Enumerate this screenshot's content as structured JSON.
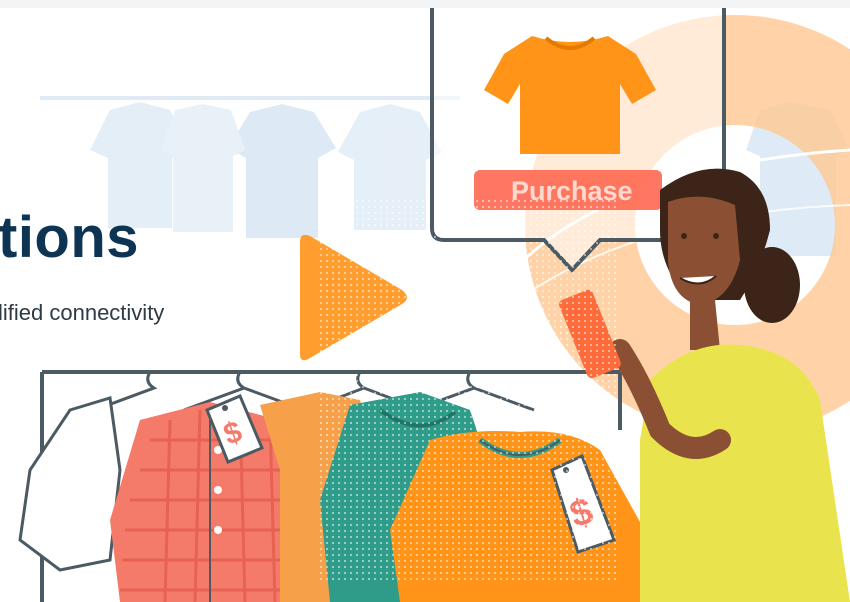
{
  "hero": {
    "headline": "tions",
    "subheadline": "lified connectivity"
  },
  "product_card": {
    "button_label": "Purchase",
    "item_icon": "tshirt-icon"
  },
  "video": {
    "control_icon": "play-icon"
  },
  "price_tags": {
    "symbol": "$"
  },
  "colors": {
    "headline": "#0d3553",
    "accent_orange": "#ff9418",
    "purchase_red": "#ff6b55",
    "peach_ring": "#ffc891",
    "shirt_pink": "#f47a6a",
    "shirt_teal": "#2f9c8a",
    "skin": "#8b5034",
    "top_yellow": "#e9e44e"
  }
}
